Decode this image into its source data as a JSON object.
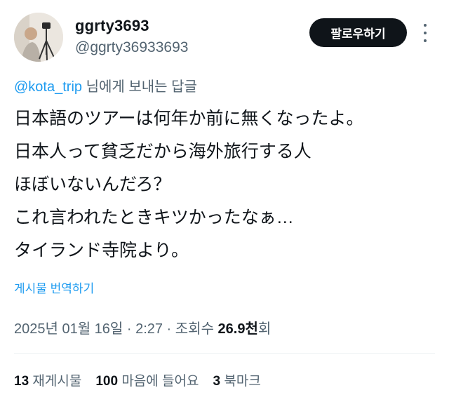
{
  "user": {
    "display_name": "ggrty3693",
    "handle": "@ggrty36933693",
    "follow_label": "팔로우하기"
  },
  "reply": {
    "mention": "@kota_trip",
    "suffix": " 님에게 보내는 답글"
  },
  "tweet_lines": [
    "日本語のツアーは何年か前に無くなったよ。",
    "日本人って貧乏だから海外旅行する人",
    "ほぼいないんだろ？",
    "これ言われたときキツかったなぁ…",
    "タイランド寺院より。"
  ],
  "translate_label": "게시물 번역하기",
  "meta": {
    "timestamp": "2025년 01월 16일 · 2:27 · 조회수 ",
    "views": "26.9천",
    "views_suffix": "회"
  },
  "stats": {
    "reposts_count": "13",
    "reposts_label": "재게시물",
    "likes_count": "100",
    "likes_label": "마음에 들어요",
    "bookmarks_count": "3",
    "bookmarks_label": "북마크"
  },
  "icons": {
    "avatar": "profile-photo",
    "more": "more-options-icon"
  }
}
